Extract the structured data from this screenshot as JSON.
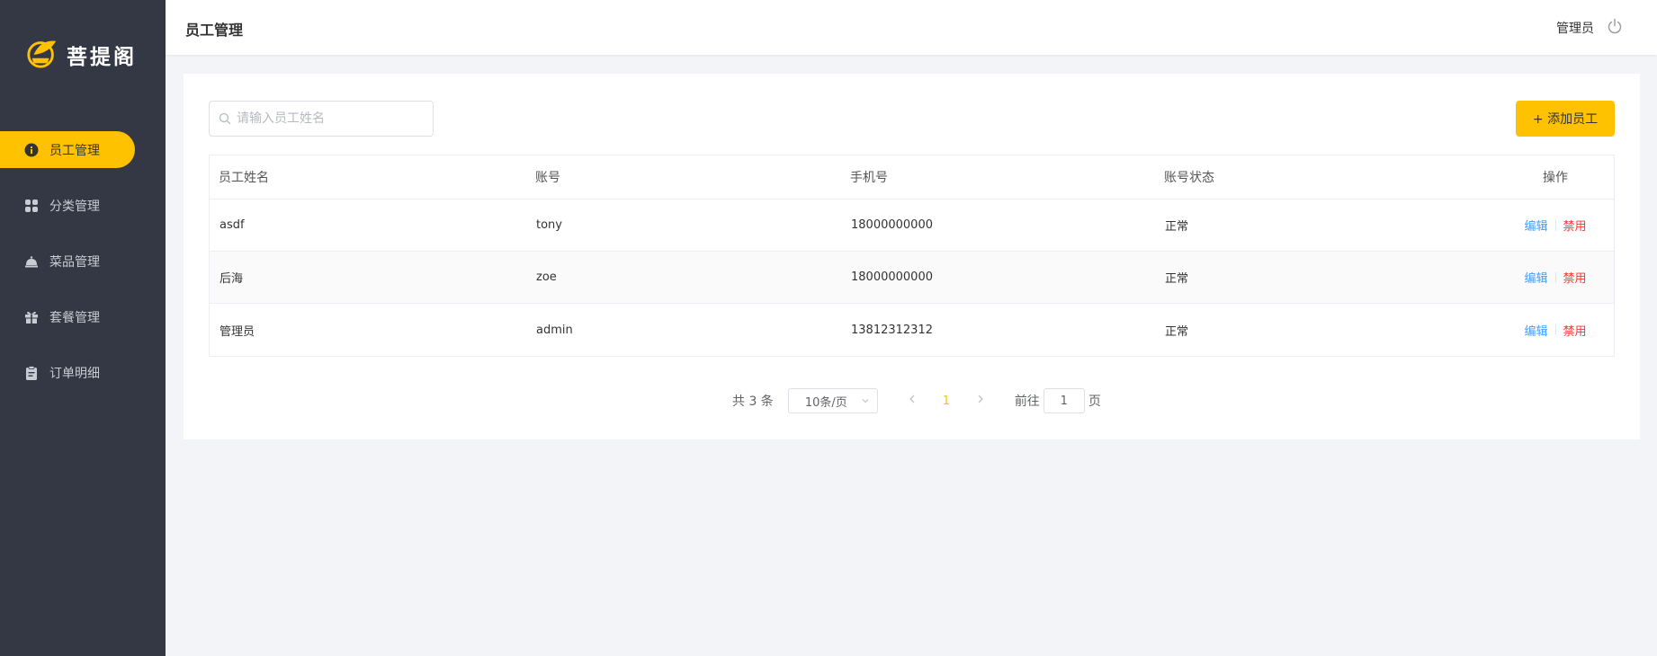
{
  "brand": {
    "name": "菩提阁"
  },
  "sidebar": {
    "items": [
      {
        "label": "员工管理",
        "icon": "employee-icon",
        "active": true
      },
      {
        "label": "分类管理",
        "icon": "category-icon",
        "active": false
      },
      {
        "label": "菜品管理",
        "icon": "dish-icon",
        "active": false
      },
      {
        "label": "套餐管理",
        "icon": "gift-icon",
        "active": false
      },
      {
        "label": "订单明细",
        "icon": "clipboard-icon",
        "active": false
      }
    ]
  },
  "header": {
    "title": "员工管理",
    "user": "管理员",
    "logout_icon": "power-icon"
  },
  "toolbar": {
    "search_placeholder": "请输入员工姓名",
    "search_value": "",
    "add_label": "+ 添加员工"
  },
  "table": {
    "columns": [
      "员工姓名",
      "账号",
      "手机号",
      "账号状态",
      "操作"
    ],
    "rows": [
      {
        "name": "asdf",
        "account": "tony",
        "phone": "18000000000",
        "status": "正常",
        "edit": "编辑",
        "disable": "禁用"
      },
      {
        "name": "后海",
        "account": "zoe",
        "phone": "18000000000",
        "status": "正常",
        "edit": "编辑",
        "disable": "禁用"
      },
      {
        "name": "管理员",
        "account": "admin",
        "phone": "13812312312",
        "status": "正常",
        "edit": "编辑",
        "disable": "禁用"
      }
    ]
  },
  "pagination": {
    "total_label": "共 3 条",
    "page_size": "10条/页",
    "current_page": "1",
    "goto_prefix": "前往",
    "goto_value": "1",
    "goto_suffix": "页"
  },
  "colors": {
    "accent": "#ffc200",
    "sidebar_bg": "#343744",
    "edit_link": "#419eff",
    "disable_link": "#fd3333"
  }
}
